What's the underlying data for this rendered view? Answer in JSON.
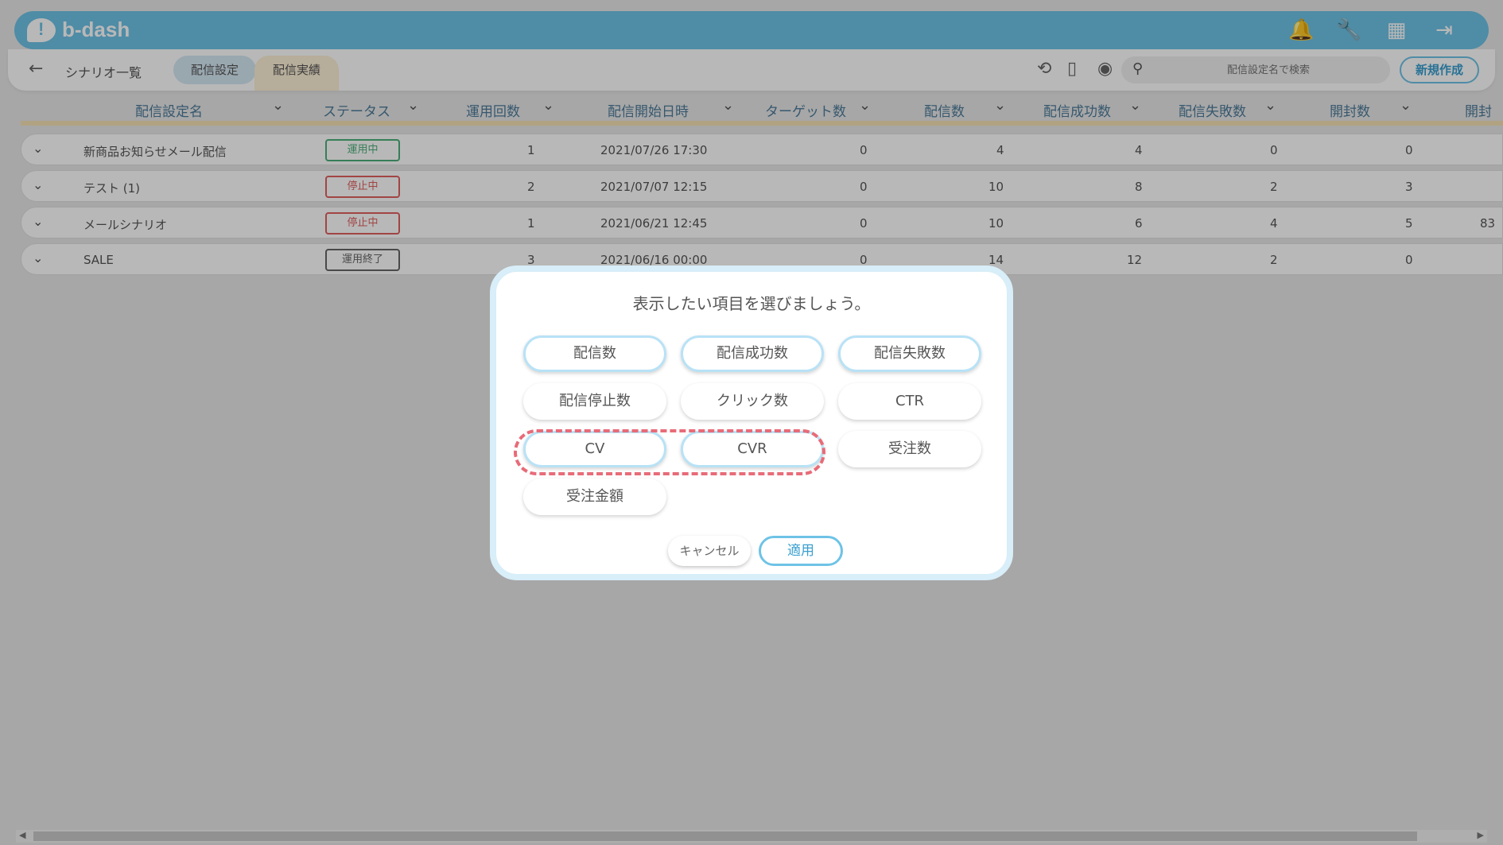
{
  "header": {
    "logo_text": "b-dash",
    "icons": [
      "bell-icon",
      "wrench-icon",
      "grid-icon",
      "logout-icon"
    ]
  },
  "subbar": {
    "crumb": "シナリオ一覧",
    "tab_settings": "配信設定",
    "tab_results": "配信実績",
    "search_placeholder": "配信設定名で検索",
    "new_button": "新規作成"
  },
  "table": {
    "columns": [
      "配信設定名",
      "ステータス",
      "運用回数",
      "配信開始日時",
      "ターゲット数",
      "配信数",
      "配信成功数",
      "配信失敗数",
      "開封数",
      "開封"
    ],
    "rows": [
      {
        "name": "新商品お知らせメール配信",
        "status": "運用中",
        "runs": "1",
        "start": "2021/07/26 17:30",
        "target": "0",
        "sent": "4",
        "success": "4",
        "fail": "0",
        "open": "0",
        "extra": ""
      },
      {
        "name": "テスト (1)",
        "status": "停止中",
        "runs": "2",
        "start": "2021/07/07 12:15",
        "target": "0",
        "sent": "10",
        "success": "8",
        "fail": "2",
        "open": "3",
        "extra": ""
      },
      {
        "name": "メールシナリオ",
        "status": "停止中",
        "runs": "1",
        "start": "2021/06/21 12:45",
        "target": "0",
        "sent": "10",
        "success": "6",
        "fail": "4",
        "open": "5",
        "extra": "83"
      },
      {
        "name": "SALE",
        "status": "運用終了",
        "runs": "3",
        "start": "2021/06/16 00:00",
        "target": "0",
        "sent": "14",
        "success": "12",
        "fail": "2",
        "open": "0",
        "extra": ""
      }
    ]
  },
  "colors": {
    "accent": "#6ec3e6",
    "status_active": "#4caf7a",
    "status_stopped": "#e0605f",
    "status_ended": "#666666",
    "highlight": "#e86b78"
  },
  "modal": {
    "title": "表示したい項目を選びましょう。",
    "options": [
      {
        "label": "配信数",
        "selected": true
      },
      {
        "label": "配信成功数",
        "selected": true
      },
      {
        "label": "配信失敗数",
        "selected": true
      },
      {
        "label": "配信停止数",
        "selected": false
      },
      {
        "label": "クリック数",
        "selected": false
      },
      {
        "label": "CTR",
        "selected": false
      },
      {
        "label": "CV",
        "selected": true
      },
      {
        "label": "CVR",
        "selected": true
      },
      {
        "label": "受注数",
        "selected": false
      },
      {
        "label": "受注金額",
        "selected": false
      }
    ],
    "cancel": "キャンセル",
    "apply": "適用"
  }
}
